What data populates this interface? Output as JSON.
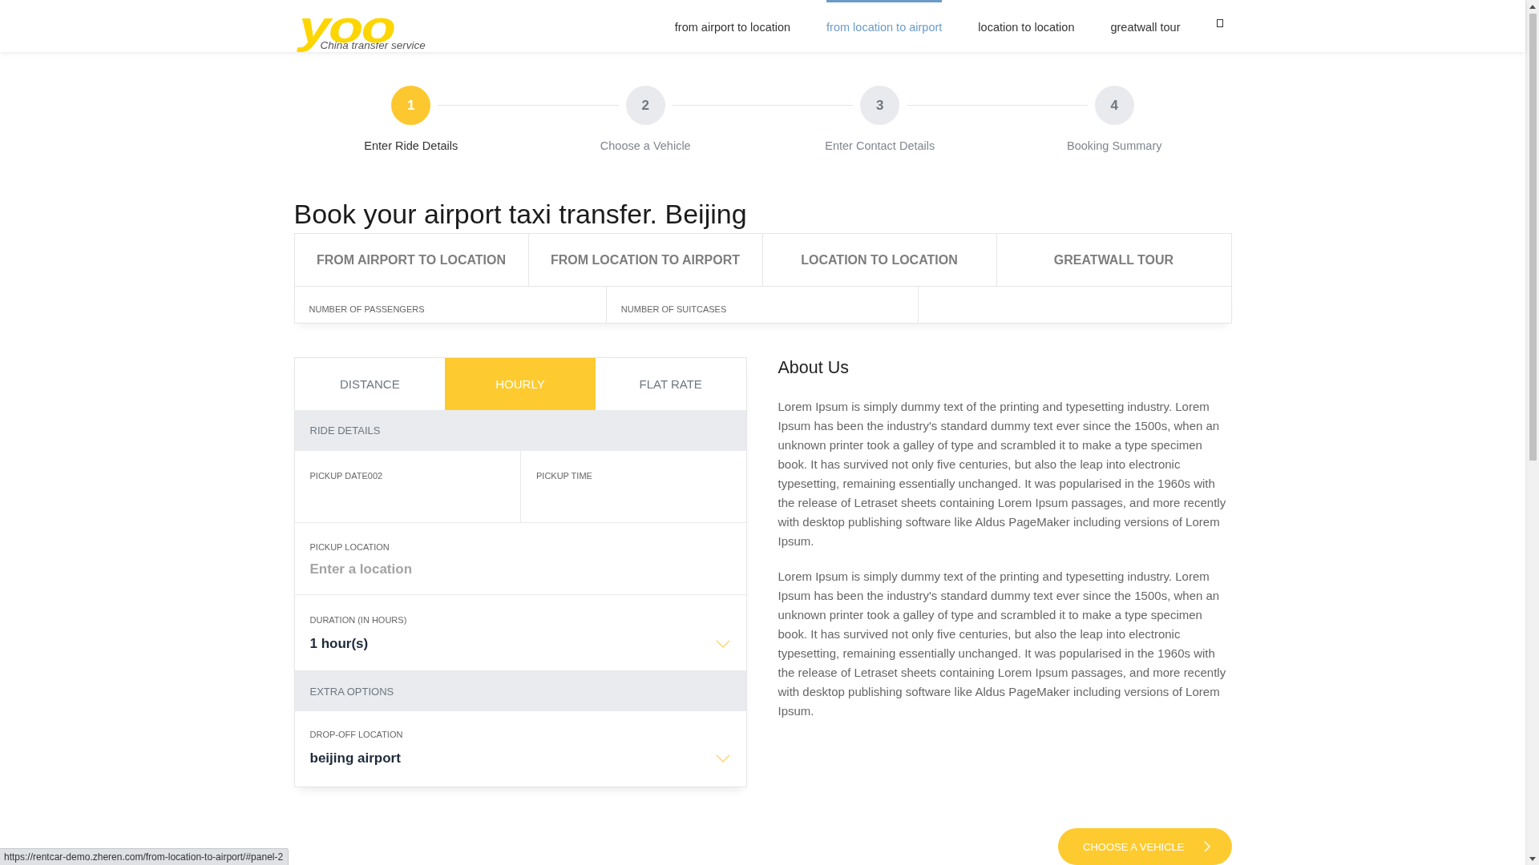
{
  "header": {
    "logo": {
      "mark": "yoo",
      "tagline": "China transfer service"
    },
    "nav": [
      {
        "label": "from airport to location",
        "selected": false
      },
      {
        "label": "from location to airport",
        "selected": true
      },
      {
        "label": "location to location",
        "selected": false
      },
      {
        "label": "greatwall tour",
        "selected": false
      }
    ]
  },
  "steps": [
    {
      "number": "1",
      "label": "Enter Ride Details",
      "active": true
    },
    {
      "number": "2",
      "label": "Choose a Vehicle",
      "active": false
    },
    {
      "number": "3",
      "label": "Enter Contact Details",
      "active": false
    },
    {
      "number": "4",
      "label": "Booking Summary",
      "active": false
    }
  ],
  "trip": {
    "title": "Book your airport taxi transfer. Beijing",
    "service_tabs": [
      {
        "label": "FROM AIRPORT TO LOCATION",
        "selected": false
      },
      {
        "label": "FROM LOCATION TO AIRPORT",
        "selected": false
      },
      {
        "label": "LOCATION TO LOCATION",
        "selected": false
      },
      {
        "label": "GREATWALL TOUR",
        "selected": false
      }
    ],
    "options": [
      {
        "label": "NUMBER OF PASSENGERS"
      },
      {
        "label": "NUMBER OF SUITCASES"
      }
    ]
  },
  "booking_form": {
    "rate_tabs": [
      {
        "label": "DISTANCE",
        "selected": false
      },
      {
        "label": "HOURLY",
        "selected": true
      },
      {
        "label": "FLAT RATE",
        "selected": false
      }
    ],
    "rows": [
      {
        "kind": "section",
        "title": "RIDE DETAILS"
      },
      {
        "kind": "pair",
        "fields": [
          {
            "label": "PICKUP DATE002"
          },
          {
            "label": "PICKUP TIME"
          }
        ]
      },
      {
        "kind": "text",
        "label": "PICKUP LOCATION",
        "placeholder": "Enter a location"
      },
      {
        "kind": "select",
        "label": "DURATION (IN HOURS)",
        "value": "1 hour(s)"
      },
      {
        "kind": "section",
        "title": "EXTRA OPTIONS"
      },
      {
        "kind": "select",
        "label": "DROP-OFF LOCATION",
        "value": "beijing airport"
      }
    ]
  },
  "about": {
    "title": "About Us",
    "paragraphs": [
      "Lorem Ipsum is simply dummy text of the printing and typesetting industry. Lorem Ipsum has been the industry's standard dummy text ever since the 1500s, when an unknown printer took a galley of type and scrambled it to make a type specimen book. It has survived not only five centuries, but also the leap into electronic typesetting, remaining essentially unchanged. It was popularised in the 1960s with the release of Letraset sheets containing Lorem Ipsum passages, and more recently with desktop publishing software like Aldus PageMaker including versions of Lorem Ipsum.",
      "Lorem Ipsum is simply dummy text of the printing and typesetting industry. Lorem Ipsum has been the industry's standard dummy text ever since the 1500s, when an unknown printer took a galley of type and scrambled it to make a type specimen book. It has survived not only five centuries, but also the leap into electronic typesetting, remaining essentially unchanged. It was popularised in the 1960s with the release of Letraset sheets containing Lorem Ipsum passages, and more recently with desktop publishing software like Aldus PageMaker including versions of Lorem Ipsum."
    ]
  },
  "next_button": {
    "label": "CHOOSE A VEHICLE"
  },
  "status_bar": {
    "url": "https://rentcar-demo.zheren.com/from-location-to-airport/#panel-2"
  }
}
